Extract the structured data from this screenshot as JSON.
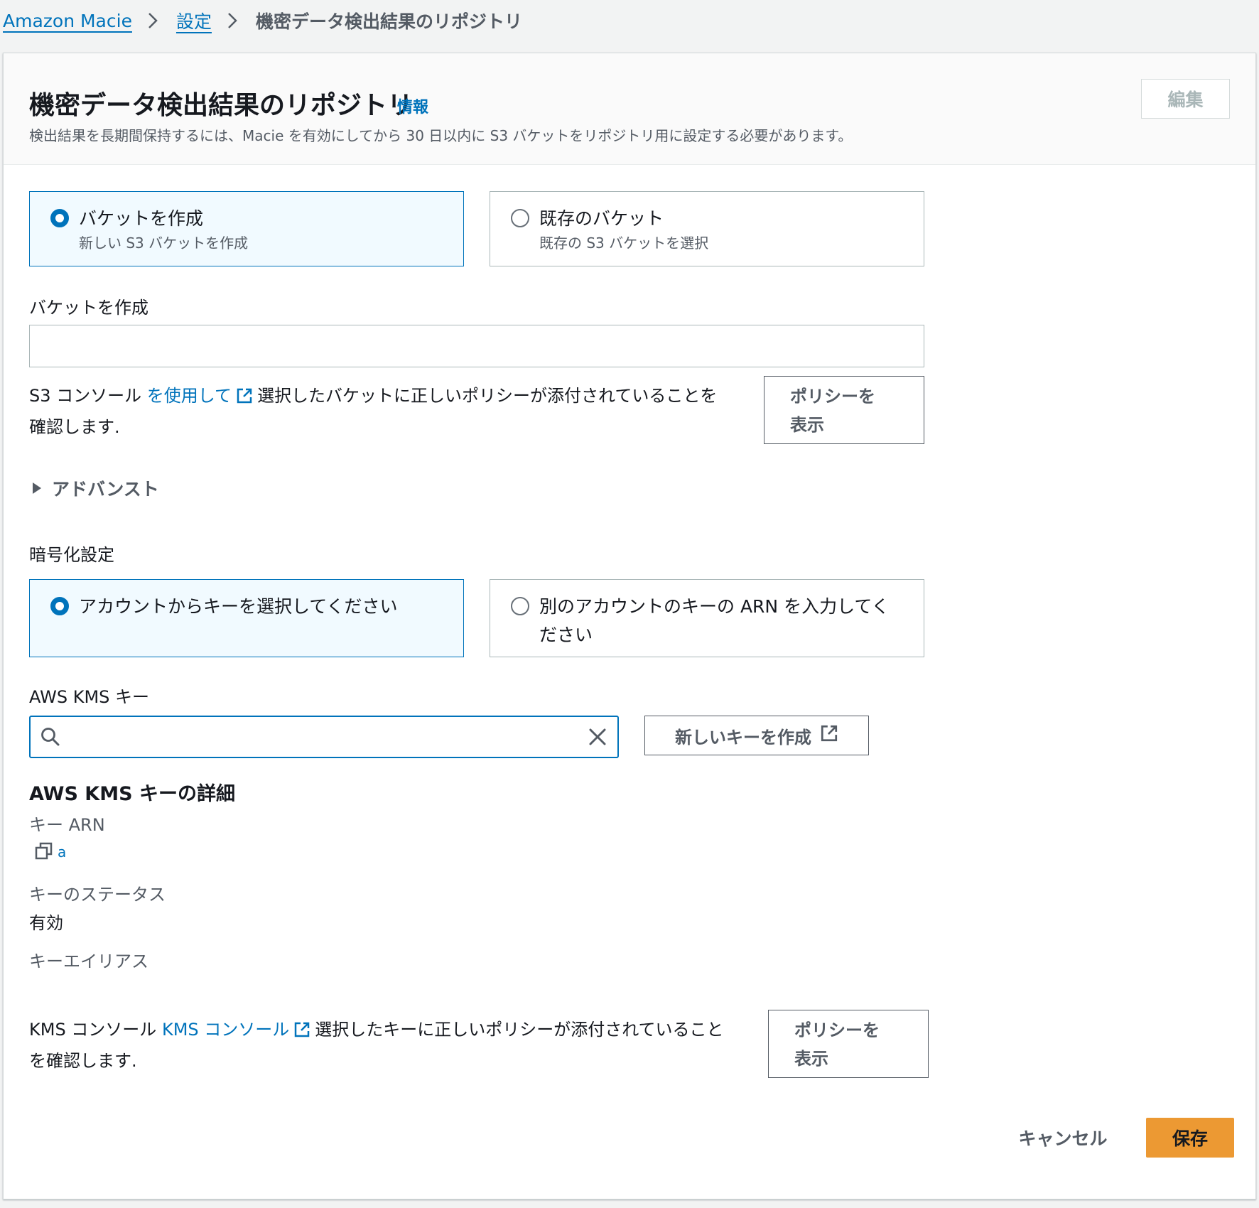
{
  "breadcrumb": {
    "items": [
      "Amazon Macie",
      "設定"
    ],
    "current": "機密データ検出結果のリポジトリ"
  },
  "header": {
    "title": "機密データ検出結果のリポジトリ",
    "info": "情報",
    "description": "検出結果を長期間保持するには、Macie を有効にしてから 30 日以内に S3 バケットをリポジトリ用に設定する必要があります。",
    "edit_label": "編集"
  },
  "bucket_options": [
    {
      "label": "バケットを作成",
      "description": "新しい S3 バケットを作成",
      "selected": true
    },
    {
      "label": "既存のバケット",
      "description": "既存の S3 バケットを選択",
      "selected": false
    }
  ],
  "bucket": {
    "label": "バケットを作成",
    "value": "",
    "policy_text_pre": "S3 コンソール",
    "policy_link": "を使用して",
    "policy_text_post_1": "選択したバケットに正しいポリシーが添付されていることを",
    "policy_text_post_2": "確認します.",
    "policy_button_line1": "ポリシーを",
    "policy_button_line2": "表示"
  },
  "advanced": {
    "label": "アドバンスト"
  },
  "encryption": {
    "label": "暗号化設定",
    "options": [
      {
        "label": "アカウントからキーを選択してください",
        "selected": true
      },
      {
        "label_line1": "別のアカウントのキーの ARN を入力してく",
        "label_line2": "ださい",
        "selected": false
      }
    ]
  },
  "kms": {
    "label": "AWS KMS キー",
    "search_value": "",
    "new_key_label": "新しいキーを作成",
    "details_title": "AWS KMS キーの詳細",
    "arn_label": "キー ARN",
    "arn_value_truncated": "a",
    "status_label": "キーのステータス",
    "status_value": "有効",
    "alias_label": "キーエイリアス",
    "policy_text_pre": "KMS コンソール",
    "policy_link": "KMS コンソール",
    "policy_text_post_1": "選択したキーに正しいポリシーが添付されていること",
    "policy_text_post_2": "を確認します.",
    "policy_button_line1": "ポリシーを",
    "policy_button_line2": "表示"
  },
  "footer": {
    "cancel_label": "キャンセル",
    "save_label": "保存"
  },
  "colors": {
    "accent": "#0073bb",
    "primary_button": "#ec9933",
    "selected_tile_bg": "#f1faff"
  }
}
